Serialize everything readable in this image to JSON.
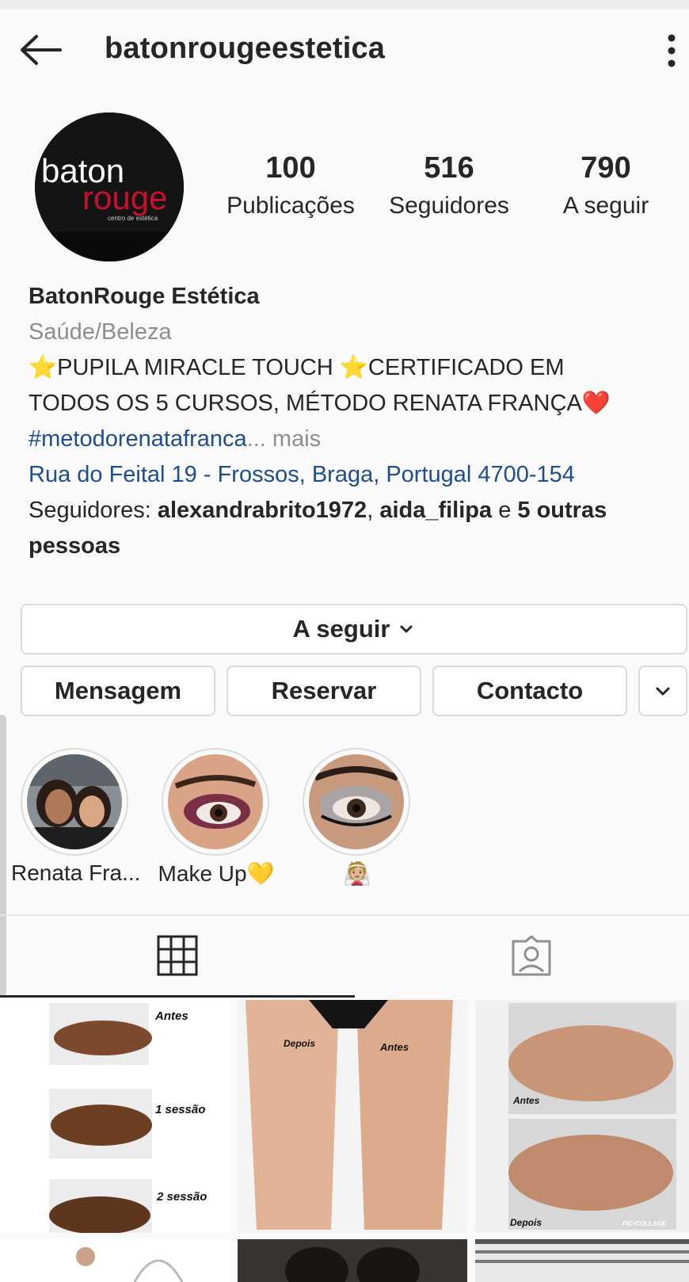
{
  "header": {
    "username": "batonrougeestetica"
  },
  "profile": {
    "logo_text_top": "baton",
    "logo_text_bottom": "rouge",
    "logo_tagline": "centro de estética",
    "stats": [
      {
        "value": "100",
        "label": "Publicações"
      },
      {
        "value": "516",
        "label": "Seguidores"
      },
      {
        "value": "790",
        "label": "A seguir"
      }
    ],
    "name": "BatonRouge Estética",
    "category": "Saúde/Beleza",
    "bio_line1": "⭐PUPILA MIRACLE TOUCH ⭐CERTIFICADO EM",
    "bio_line2": "TODOS OS 5 CURSOS, MÉTODO RENATA FRANÇA❤️",
    "hashtag": "#metodorenatafranca",
    "more": "... mais",
    "address": "Rua do Feital 19 - Frossos, Braga, Portugal 4700-154",
    "followers_prefix": "Seguidores: ",
    "follower1": "alexandrabrito1972",
    "comma": ", ",
    "follower2": "aida_filipa",
    "and": " e ",
    "others": "5 outras pessoas"
  },
  "buttons": {
    "following": "A seguir",
    "message": "Mensagem",
    "reserve": "Reservar",
    "contact": "Contacto"
  },
  "highlights": [
    {
      "label": "Renata Fra..."
    },
    {
      "label": "Make Up💛"
    },
    {
      "label": "👰🏼"
    }
  ],
  "posts": {
    "p1": {
      "c1": "Antes",
      "c2": "1 sessão",
      "c3": "2 sessão"
    },
    "p2": {
      "c1": "Depois",
      "c2": "Antes"
    },
    "p3": {
      "c1": "Antes",
      "c2": "Depois",
      "c3": "PIC•COLLAGE"
    }
  }
}
